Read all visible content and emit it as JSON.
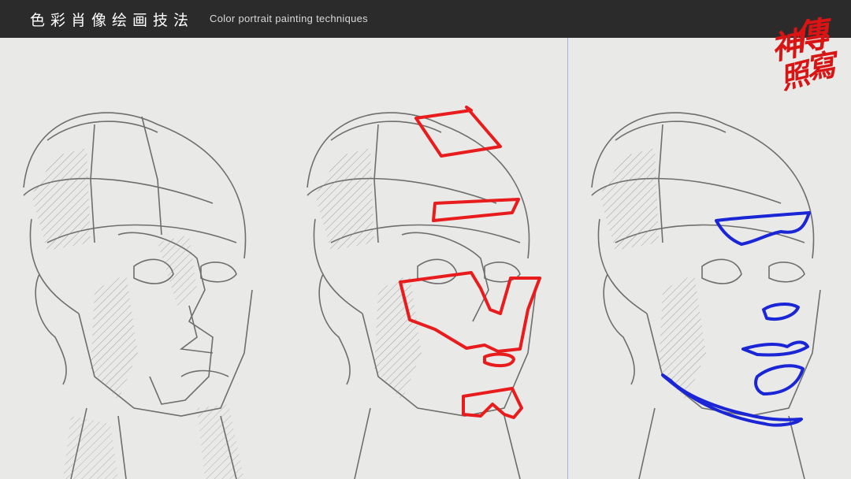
{
  "header": {
    "title_cn": "色彩肖像绘画技法",
    "title_en": "Color portrait painting techniques",
    "background": "#2c2b2b"
  },
  "seal": {
    "characters": [
      "傳",
      "神",
      "寫",
      "照"
    ],
    "color": "#d81414"
  },
  "panels": [
    {
      "name": "reference-sketch",
      "overlay": "none"
    },
    {
      "name": "highlight-planes",
      "overlay_color": "#e81c1c"
    },
    {
      "name": "shadow-planes",
      "overlay_color": "#1a26d6"
    }
  ]
}
